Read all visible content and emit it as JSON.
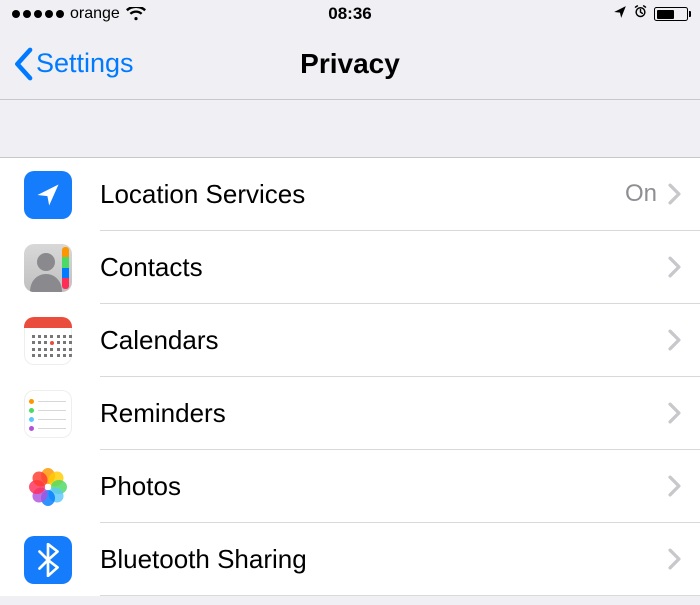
{
  "statusbar": {
    "carrier": "orange",
    "time": "08:36"
  },
  "nav": {
    "back_label": "Settings",
    "title": "Privacy"
  },
  "rows": {
    "location": {
      "label": "Location Services",
      "value": "On"
    },
    "contacts": {
      "label": "Contacts"
    },
    "calendars": {
      "label": "Calendars"
    },
    "reminders": {
      "label": "Reminders"
    },
    "photos": {
      "label": "Photos"
    },
    "bluetooth": {
      "label": "Bluetooth Sharing"
    }
  }
}
